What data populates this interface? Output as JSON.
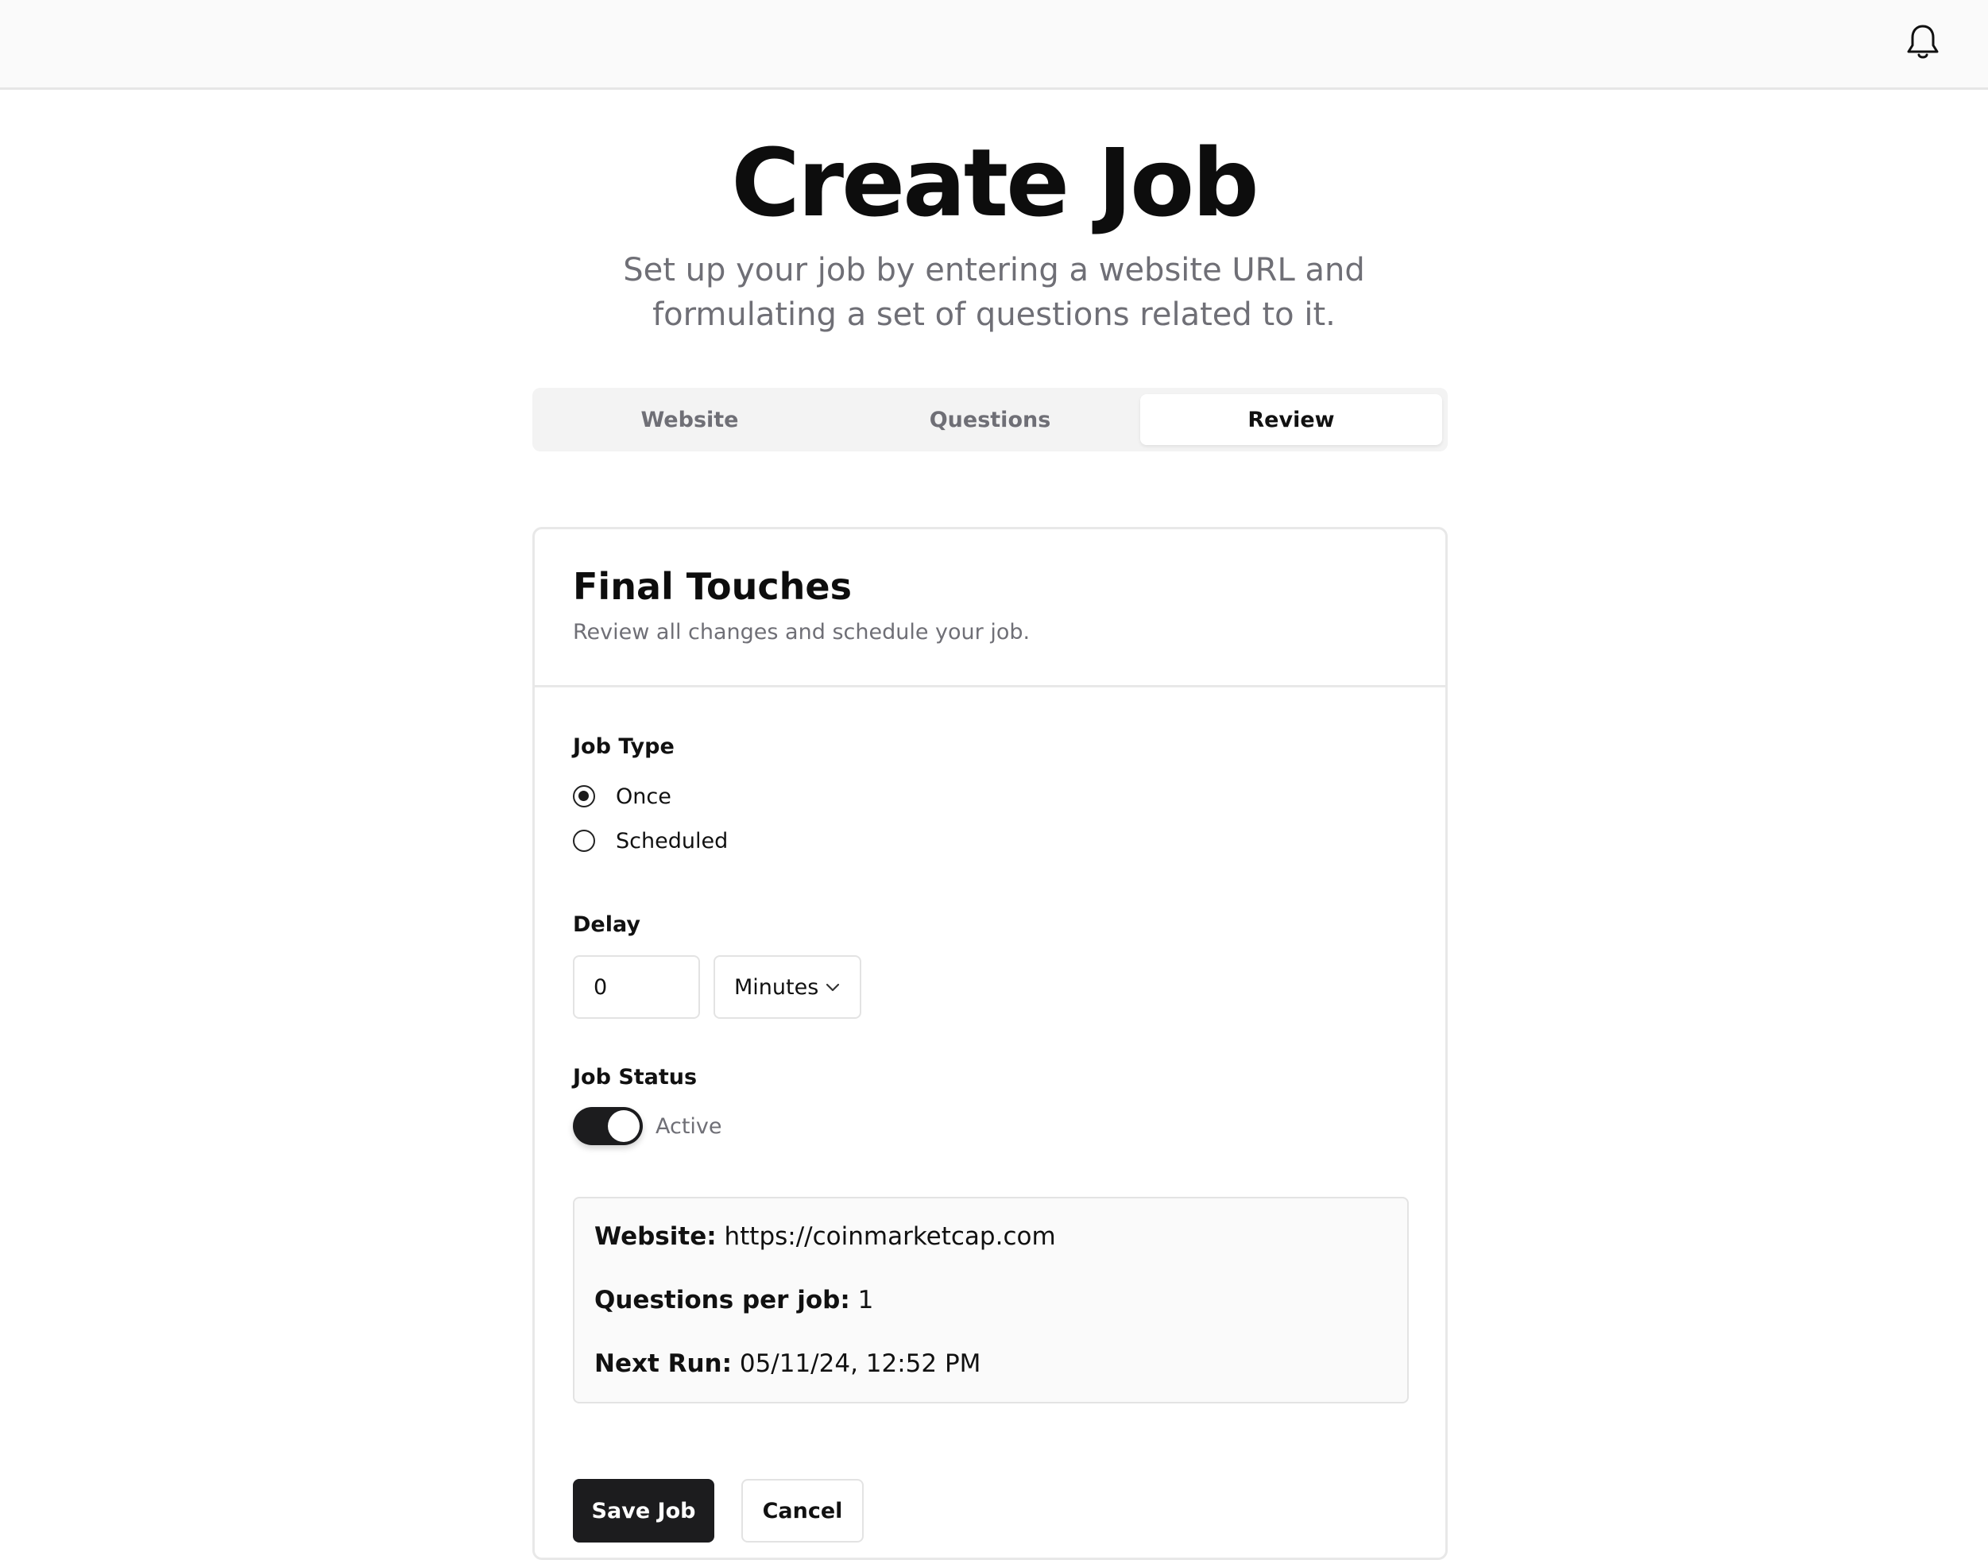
{
  "header": {
    "notifications_icon": "bell-icon"
  },
  "page": {
    "title": "Create Job",
    "subtitle_line1": "Set up your job by entering a website URL and",
    "subtitle_line2": "formulating a set of questions related to it."
  },
  "tabs": [
    {
      "label": "Website",
      "active": false
    },
    {
      "label": "Questions",
      "active": false
    },
    {
      "label": "Review",
      "active": true
    }
  ],
  "card": {
    "title": "Final Touches",
    "description": "Review all changes and schedule your job."
  },
  "job_type": {
    "label": "Job Type",
    "options": [
      {
        "label": "Once",
        "selected": true
      },
      {
        "label": "Scheduled",
        "selected": false
      }
    ]
  },
  "delay": {
    "label": "Delay",
    "value": "0",
    "unit": "Minutes"
  },
  "job_status": {
    "label": "Job Status",
    "state_label": "Active",
    "enabled": true
  },
  "summary": {
    "website_key": "Website:",
    "website_value": "https://coinmarketcap.com",
    "questions_key": "Questions per job:",
    "questions_value": "1",
    "next_run_key": "Next Run:",
    "next_run_value": "05/11/24, 12:52 PM"
  },
  "actions": {
    "save_label": "Save Job",
    "cancel_label": "Cancel"
  }
}
